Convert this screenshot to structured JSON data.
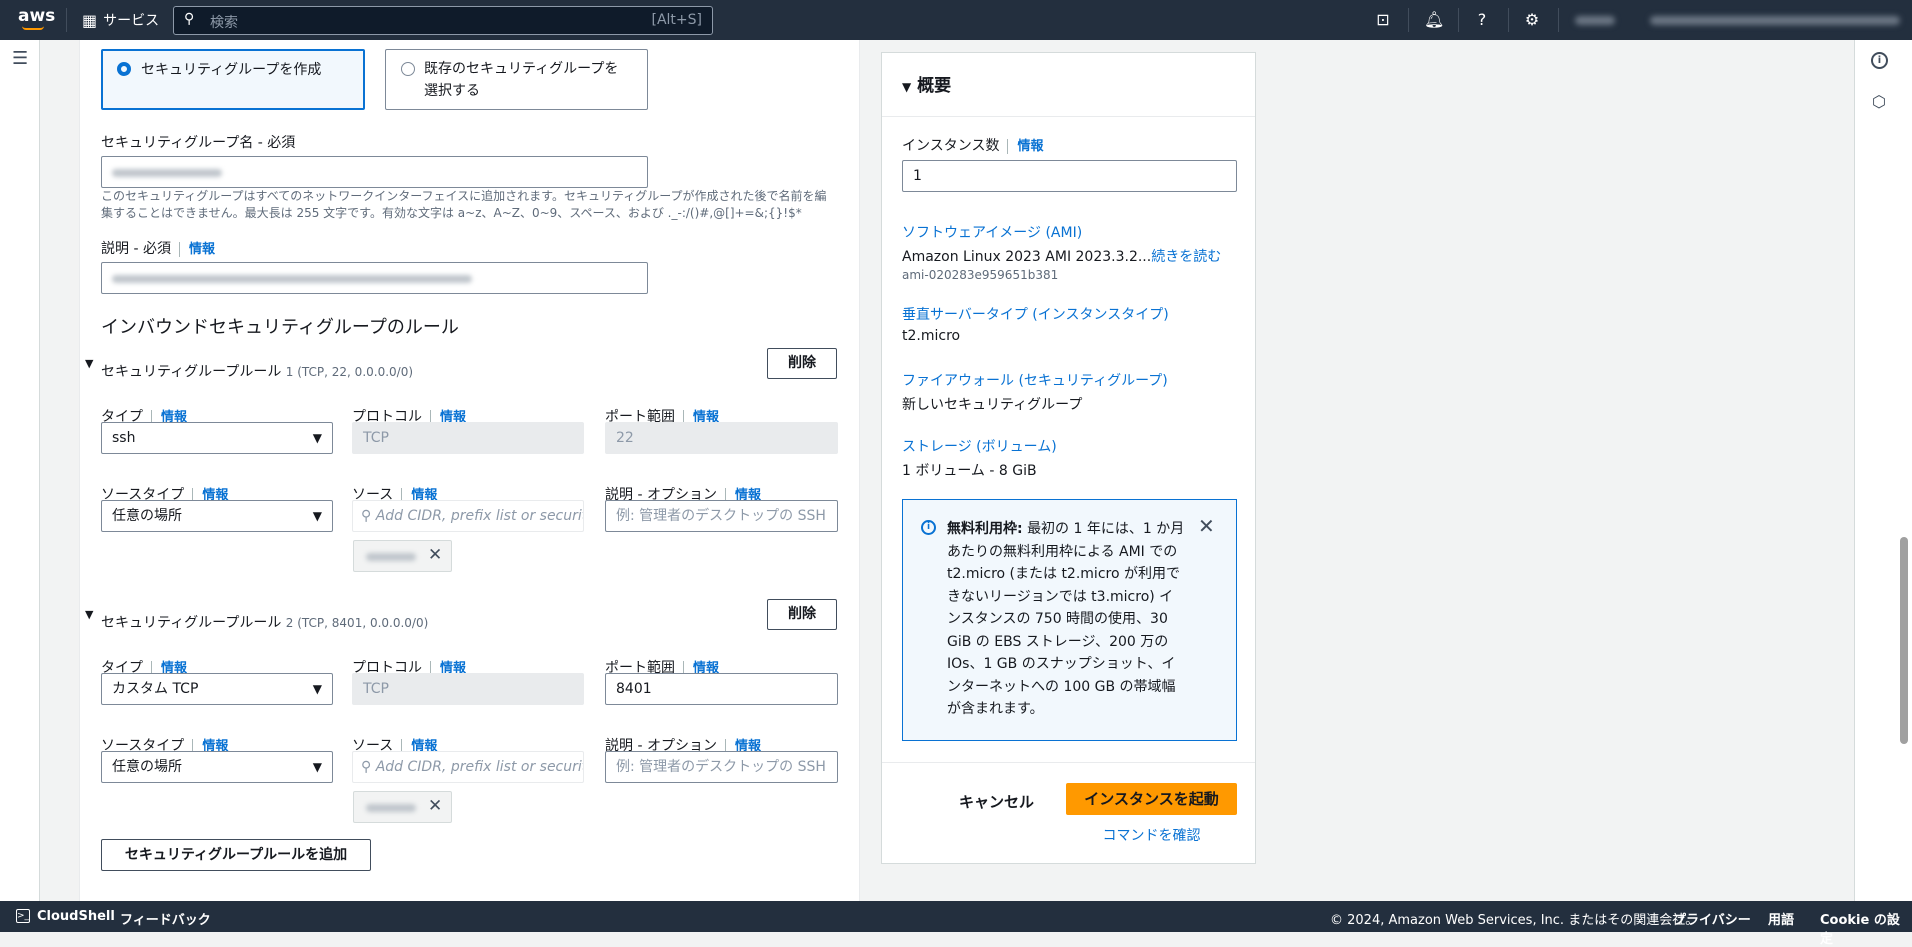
{
  "topbar": {
    "logo": "aws",
    "services": "サービス",
    "search_placeholder": "検索",
    "search_shortcut": "[Alt+S]"
  },
  "sg_choice": {
    "create": "セキュリティグループを作成",
    "existing_line1": "既存のセキュリティグループを",
    "existing_line2": "選択する",
    "selected": "create"
  },
  "sg_name": {
    "label": "セキュリティグループ名 - 必須",
    "help_line1": "このセキュリティグループはすべてのネットワークインターフェイスに追加されます。セキュリティグループが作成された後で名前を編",
    "help_line2": "集することはできません。最大長は 255 文字です。有効な文字は a~z、A~Z、0~9、スペース、および ._-:/()#,@[]+=&;{}!$*"
  },
  "description": {
    "label": "説明 - 必須",
    "info": "情報"
  },
  "inbound": {
    "heading": "インバウンドセキュリティグループのルール",
    "rules": [
      {
        "title": "セキュリティグループルール",
        "meta": "1 (TCP, 22, 0.0.0.0/0)",
        "delete": "削除",
        "type_label": "タイプ",
        "type": "ssh",
        "protocol_label": "プロトコル",
        "protocol": "TCP",
        "port_label": "ポート範囲",
        "port": "22",
        "source_type_label": "ソースタイプ",
        "source_type": "任意の場所",
        "source_label": "ソース",
        "source_placeholder": "Add CIDR, prefix list or security",
        "desc_label": "説明 - オプション",
        "desc_placeholder": "例: 管理者のデスクトップの SSH"
      },
      {
        "title": "セキュリティグループルール",
        "meta": "2 (TCP, 8401, 0.0.0.0/0)",
        "delete": "削除",
        "type_label": "タイプ",
        "type": "カスタム TCP",
        "protocol_label": "プロトコル",
        "protocol": "TCP",
        "port_label": "ポート範囲",
        "port": "8401",
        "source_type_label": "ソースタイプ",
        "source_type": "任意の場所",
        "source_label": "ソース",
        "source_placeholder": "Add CIDR, prefix list or security",
        "desc_label": "説明 - オプション",
        "desc_placeholder": "例: 管理者のデスクトップの SSH"
      }
    ],
    "add_rule": "セキュリティグループルールを追加"
  },
  "info": "情報",
  "summary": {
    "title": "概要",
    "instances_label": "インスタンス数",
    "instances": "1",
    "ami_label": "ソフトウェアイメージ (AMI)",
    "ami_value": "Amazon Linux 2023 AMI 2023.3.2...",
    "ami_more": "続きを読む",
    "ami_id": "ami-020283e959651b381",
    "type_label": "垂直サーバータイプ (インスタンスタイプ)",
    "type_value": "t2.micro",
    "fw_label": "ファイアウォール (セキュリティグループ)",
    "fw_value": "新しいセキュリティグループ",
    "storage_label": "ストレージ (ボリューム)",
    "storage_value": "1 ボリューム - 8 GiB",
    "free_tier_bold": "無料利用枠:",
    "free_tier_text": "最初の 1 年には、1 か月あたりの無料利用枠による AMI での t2.micro (または t2.micro が利用できないリージョンでは t3.micro) インスタンスの 750 時間の使用、30 GiB の EBS ストレージ、200 万の IOs、1 GB のスナップショット、インターネットへの 100 GB の帯域幅が含まれます。",
    "cancel": "キャンセル",
    "launch": "インスタンスを起動",
    "review": "コマンドを確認"
  },
  "footer": {
    "cloudshell": "CloudShell",
    "feedback": "フィードバック",
    "copyright": "© 2024, Amazon Web Services, Inc. またはその関連会社。",
    "privacy": "プライバシー",
    "terms": "用語",
    "cookie": "Cookie の設定"
  },
  "colors": {
    "accent": "#0972d3",
    "launch": "#ff9900",
    "nav": "#232f3e"
  }
}
